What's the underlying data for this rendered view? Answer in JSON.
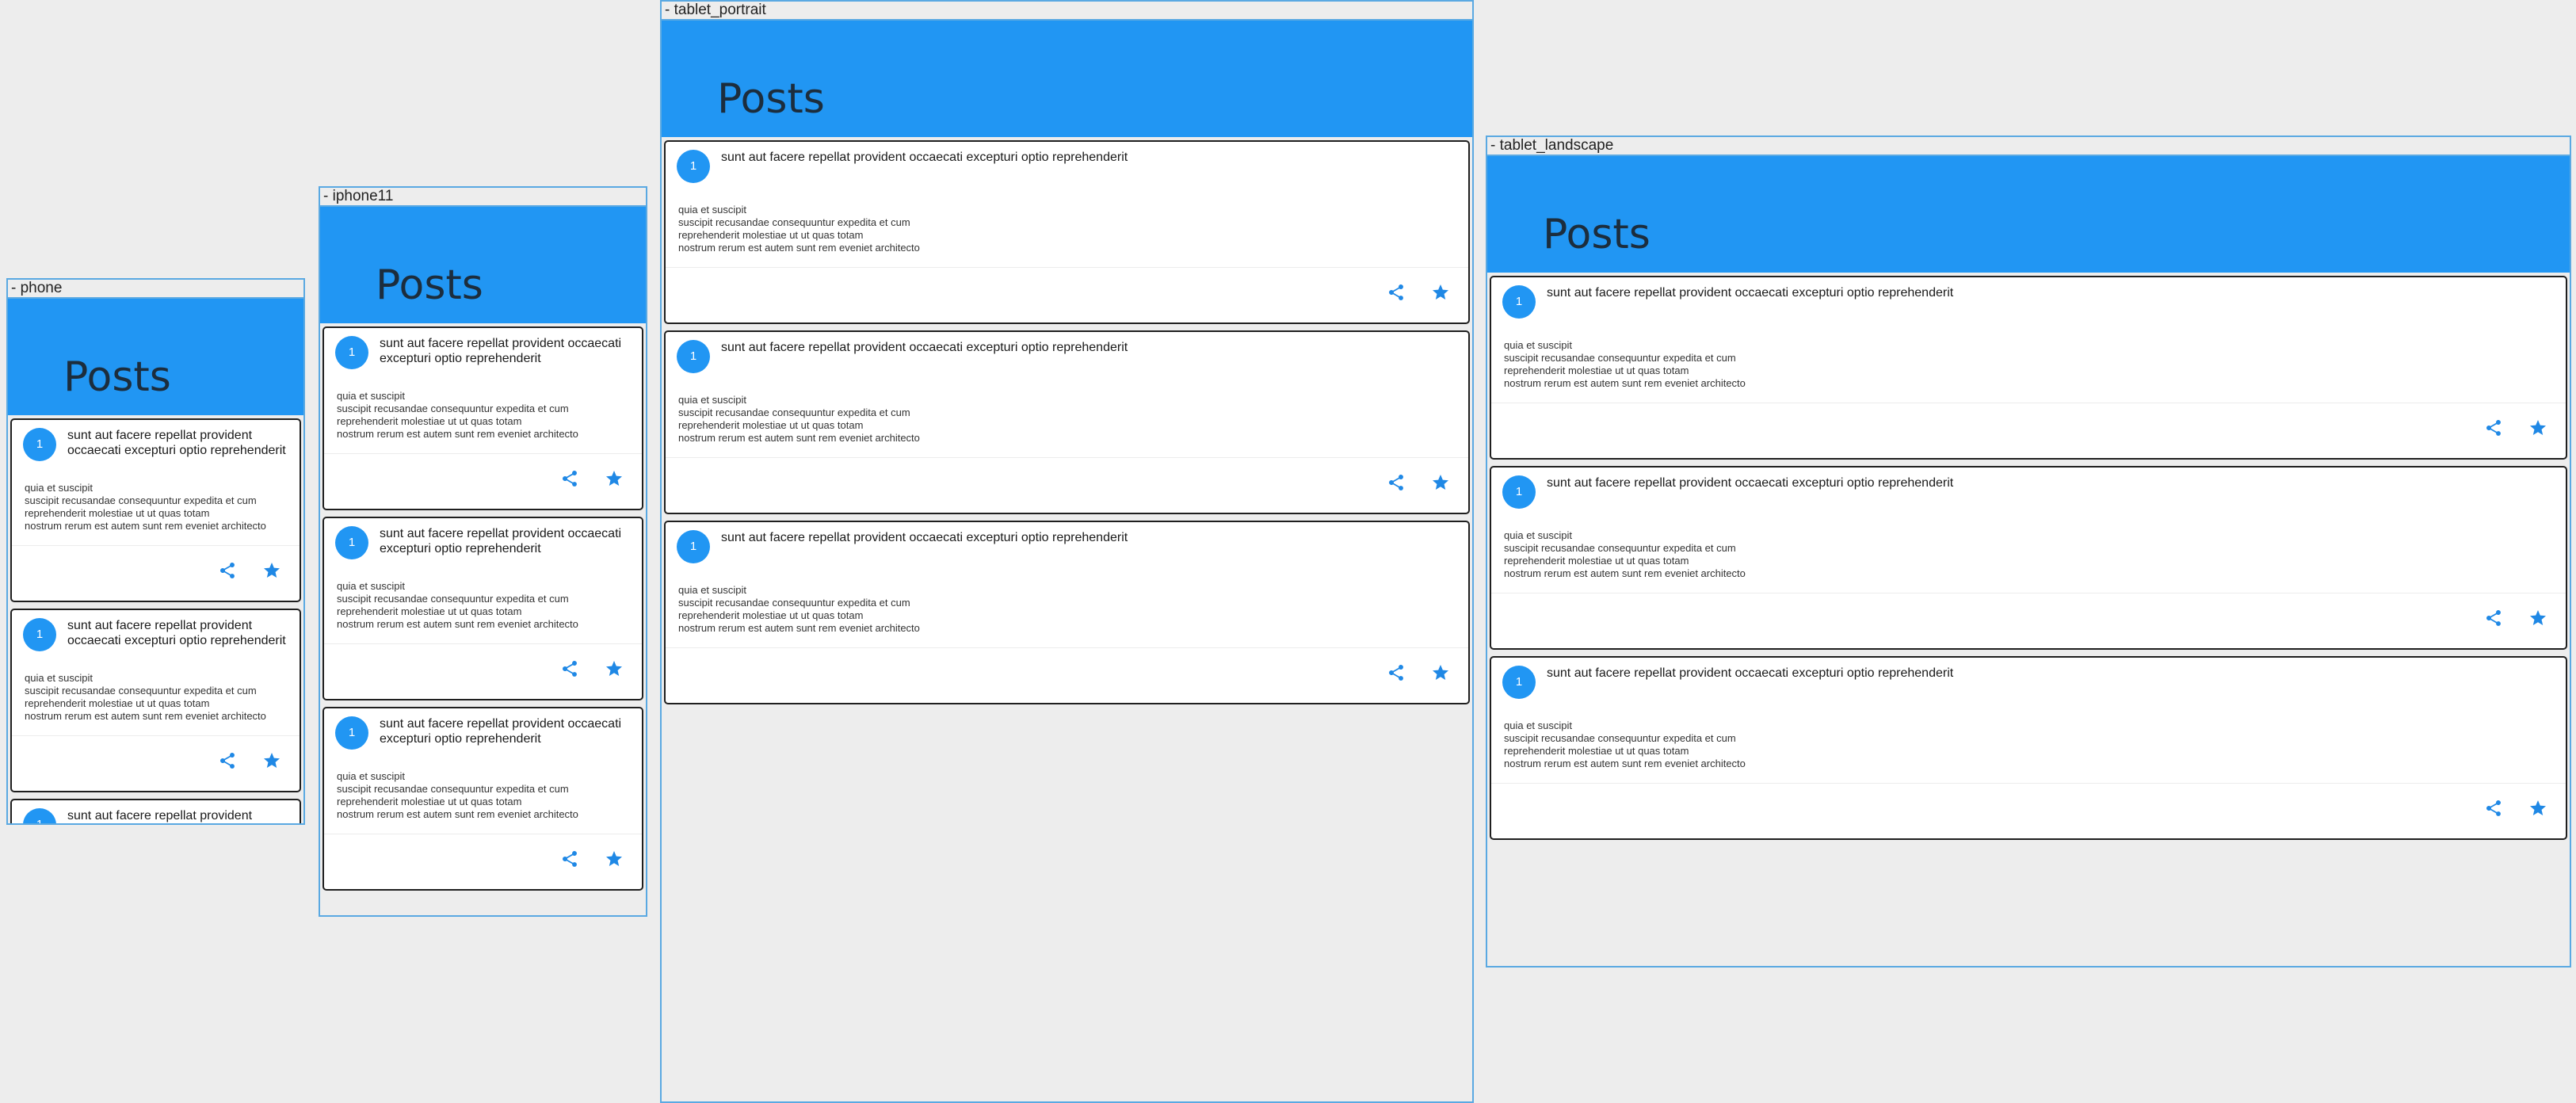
{
  "devices": [
    {
      "label": "- phone"
    },
    {
      "label": "- iphone11"
    },
    {
      "label": "- tablet_portrait"
    },
    {
      "label": "- tablet_landscape"
    }
  ],
  "appbar": {
    "title": "Posts"
  },
  "post": {
    "id": "1",
    "title": "sunt aut facere repellat provident occaecati excepturi optio reprehenderit",
    "body": "quia et suscipit\nsuscipit recusandae consequuntur expedita et cum\nreprehenderit molestiae ut ut quas totam\nnostrum rerum est autem sunt rem eveniet architecto"
  },
  "icons": {
    "share": "share-icon",
    "favorite": "star-icon",
    "accent": "#2196f3"
  }
}
